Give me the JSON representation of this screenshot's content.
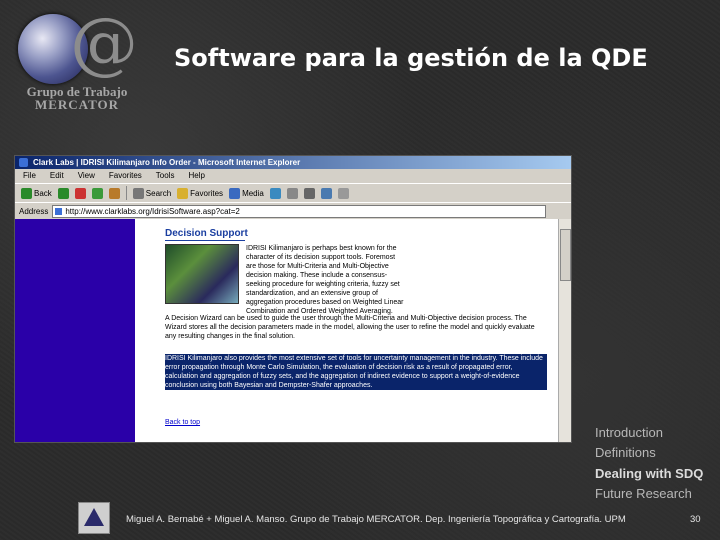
{
  "logo": {
    "line1": "Grupo de Trabajo",
    "line2": "MERCATOR"
  },
  "title": "Software para la gestión de la QDE",
  "browser": {
    "window_title": "Clark Labs | IDRISI Kilimanjaro Info Order - Microsoft Internet Explorer",
    "menu": [
      "File",
      "Edit",
      "View",
      "Favorites",
      "Tools",
      "Help"
    ],
    "toolbar": {
      "back": "Back",
      "search": "Search",
      "favorites": "Favorites",
      "media": "Media"
    },
    "address_label": "Address",
    "address_value": "http://www.clarklabs.org/IdrisiSoftware.asp?cat=2",
    "page": {
      "heading": "Decision Support",
      "para1": "IDRISI Kilimanjaro is perhaps best known for the character of its decision support tools. Foremost are those for Multi-Criteria and Multi-Objective decision making. These include a consensus-seeking procedure for weighting criteria, fuzzy set standardization, and an extensive group of aggregation procedures based on Weighted Linear Combination and Ordered Weighted Averaging.",
      "para2": "A Decision Wizard can be used to guide the user through the Multi-Criteria and Multi-Objective decision process. The Wizard stores all the decision parameters made in the model, allowing the user to refine the model and quickly evaluate any resulting changes in the final solution.",
      "para3": "IDRISI Kilimanjaro also provides the most extensive set of tools for uncertainty management in the industry. These include error propagation through Monte Carlo Simulation, the evaluation of decision risk as a result of propagated error, calculation and aggregation of fuzzy sets, and the aggregation of indirect evidence to support a weight-of-evidence conclusion using both Bayesian and Dempster-Shafer approaches.",
      "back_link": "Back to top"
    }
  },
  "side_menu": {
    "items": [
      "Introduction",
      "Definitions",
      "Dealing with SDQ",
      "Future Research"
    ],
    "active_index": 2
  },
  "footer": {
    "text": "Miguel A. Bernabé + Miguel A. Manso. Grupo de Trabajo MERCATOR. Dep. Ingeniería Topográfica y Cartografía. UPM",
    "page_number": "30"
  },
  "colors": {
    "background": "#2b2b2b",
    "browser_nav": "#2a00a8",
    "highlight": "#0a246a",
    "link": "#1a3ea0"
  }
}
